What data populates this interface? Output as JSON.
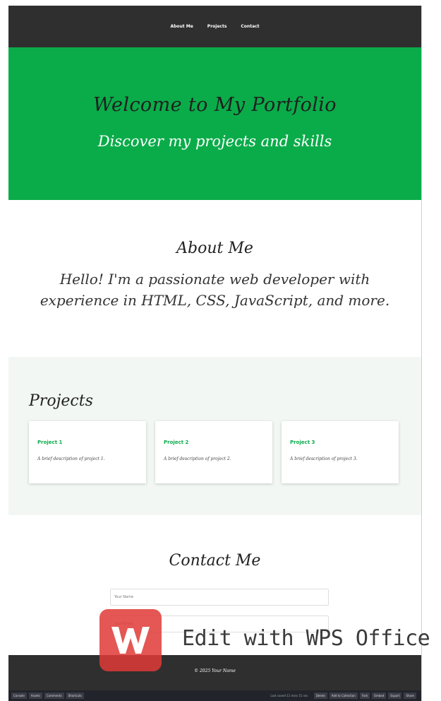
{
  "nav": {
    "items": [
      "About Me",
      "Projects",
      "Contact"
    ]
  },
  "hero": {
    "title": "Welcome to My Portfolio",
    "subtitle": "Discover my projects and skills"
  },
  "about": {
    "heading": "About Me",
    "text": "Hello! I'm a passionate web developer with experience in HTML, CSS, JavaScript, and more."
  },
  "projects": {
    "heading": "Projects",
    "items": [
      {
        "title": "Project 1",
        "desc": "A brief description of project 1."
      },
      {
        "title": "Project 2",
        "desc": "A brief description of project 2."
      },
      {
        "title": "Project 3",
        "desc": "A brief description of project 3."
      }
    ]
  },
  "contact": {
    "heading": "Contact Me",
    "name_placeholder": "Your Name",
    "email_placeholder": "Your Email"
  },
  "footer": {
    "text": "© 2025 Your Name"
  },
  "editor": {
    "left_buttons": [
      "Console",
      "Assets",
      "Comments",
      "Shortcuts"
    ],
    "saved": "Last saved 11 mins 51 sec",
    "right_buttons": [
      "Delete",
      "Add to Collection",
      "Fork",
      "Embed",
      "Export",
      "Share"
    ]
  },
  "watermark": {
    "text": "Edit with WPS Office"
  },
  "colors": {
    "accent": "#0aac49",
    "dark": "#2f2f2f",
    "soft": "#f2f7f3"
  }
}
